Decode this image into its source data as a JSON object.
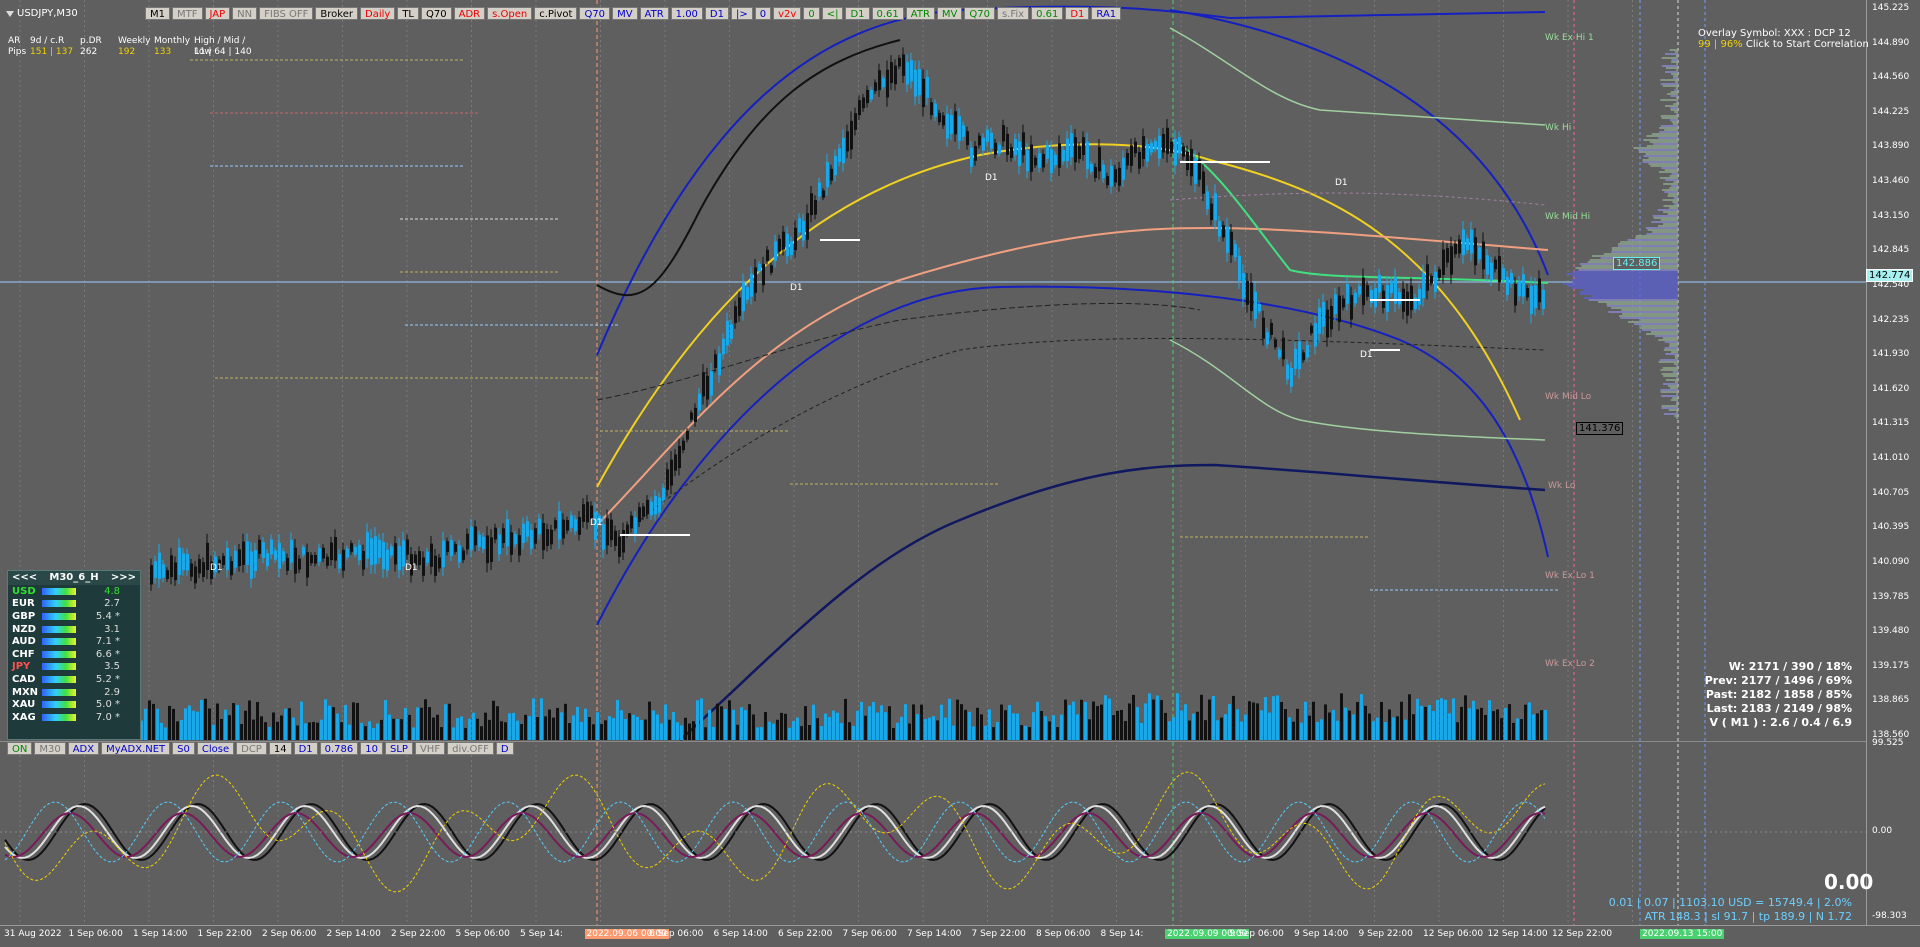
{
  "symbol_title": "USDJPY,M30",
  "toolbar": [
    {
      "label": "M1",
      "color": "black"
    },
    {
      "label": "MTF",
      "color": "grey"
    },
    {
      "label": "JAP",
      "color": "red"
    },
    {
      "label": "NN",
      "color": "grey"
    },
    {
      "label": "FIBS OFF",
      "color": "grey"
    },
    {
      "label": "Broker",
      "color": "black"
    },
    {
      "label": "Daily",
      "color": "red"
    },
    {
      "label": "TL",
      "color": "black"
    },
    {
      "label": "Q70",
      "color": "black"
    },
    {
      "label": "ADR",
      "color": "red"
    },
    {
      "label": "s.Open",
      "color": "red"
    },
    {
      "label": "c.Pivot",
      "color": "black"
    },
    {
      "label": "Q70",
      "color": "blue"
    },
    {
      "label": "MV",
      "color": "blue"
    },
    {
      "label": "ATR",
      "color": "blue"
    },
    {
      "label": "1.00",
      "color": "blue"
    },
    {
      "label": "D1",
      "color": "blue"
    },
    {
      "label": "|>",
      "color": "blue"
    },
    {
      "label": "0",
      "color": "blue"
    },
    {
      "label": "v2v",
      "color": "red"
    },
    {
      "label": "0",
      "color": "green"
    },
    {
      "label": "<|",
      "color": "green"
    },
    {
      "label": "D1",
      "color": "green"
    },
    {
      "label": "0.61",
      "color": "green"
    },
    {
      "label": "ATR",
      "color": "green"
    },
    {
      "label": "MV",
      "color": "green"
    },
    {
      "label": "Q70",
      "color": "green"
    },
    {
      "label": "s.Fix",
      "color": "grey"
    },
    {
      "label": "0.61",
      "color": "green"
    },
    {
      "label": "D1",
      "color": "red"
    },
    {
      "label": "RA1",
      "color": "blue"
    }
  ],
  "stats": {
    "header": [
      "AR",
      "9d / c.R",
      "p.DR",
      "Weekly",
      "Monthly",
      "High / Mid / Low"
    ],
    "values": [
      "Pips",
      "151 | 137",
      "262",
      "192",
      "133",
      "11 | 64 | 140"
    ]
  },
  "overlay": {
    "line1": "Overlay Symbol: XXX : DCP 12",
    "line2_pct": "99 | 96%",
    "line2_text": "Click to Start Correlation"
  },
  "strength_panel": {
    "nav_left": "<<<",
    "title": "M30_6_H",
    "nav_right": ">>>",
    "rows": [
      {
        "ccy": "USD",
        "value": "4.8",
        "color": "#30e030"
      },
      {
        "ccy": "EUR",
        "value": "2.7",
        "color": "#ffffff"
      },
      {
        "ccy": "GBP",
        "value": "5.4 *",
        "color": "#ffffff"
      },
      {
        "ccy": "NZD",
        "value": "3.1",
        "color": "#ffffff"
      },
      {
        "ccy": "AUD",
        "value": "7.1 *",
        "color": "#ffffff"
      },
      {
        "ccy": "CHF",
        "value": "6.6 *",
        "color": "#ffffff"
      },
      {
        "ccy": "JPY",
        "value": "3.5",
        "color": "#ff5050"
      },
      {
        "ccy": "CAD",
        "value": "5.2 *",
        "color": "#ffffff"
      },
      {
        "ccy": "MXN",
        "value": "2.9",
        "color": "#ffffff"
      },
      {
        "ccy": "XAU",
        "value": "5.0 *",
        "color": "#ffffff"
      },
      {
        "ccy": "XAG",
        "value": "7.0 *",
        "color": "#ffffff"
      }
    ]
  },
  "week_stats": {
    "w": "W: 2171 / 390 / 18%",
    "prev": "Prev: 2177 / 1496 / 69%",
    "past": "Past: 2182 / 1858 / 85%",
    "last": "Last: 2183 / 2149 / 98%",
    "v": "V ( M1 ) : 2.6 / 0.4 / 6.9"
  },
  "sub_toolbar": [
    {
      "label": "ON",
      "color": "green"
    },
    {
      "label": "M30",
      "color": "grey"
    },
    {
      "label": "ADX",
      "color": "blue"
    },
    {
      "label": "MyADX.NET",
      "color": "blue"
    },
    {
      "label": "S0",
      "color": "blue"
    },
    {
      "label": "Close",
      "color": "blue"
    },
    {
      "label": "DCP",
      "color": "grey"
    },
    {
      "label": "14",
      "color": "black"
    },
    {
      "label": "D1",
      "color": "blue"
    },
    {
      "label": "0.786",
      "color": "blue"
    },
    {
      "label": "10",
      "color": "blue"
    },
    {
      "label": "SLP",
      "color": "blue"
    },
    {
      "label": "VHF",
      "color": "grey"
    },
    {
      "label": "div.OFF",
      "color": "grey"
    },
    {
      "label": "D",
      "color": "blue"
    }
  ],
  "sub_value": "0.00",
  "bottom_stats": {
    "line1": "0.01  |  0.07  |  1103.10 USD = 15749.4  |  2.0%",
    "line2": "ATR 148.3  |  sl 91.7  |  tp 189.9  |  N 1.72"
  },
  "price_axis": [
    "145.225",
    "144.890",
    "144.560",
    "144.225",
    "143.890",
    "143.460",
    "143.150",
    "142.845",
    "142.540",
    "142.235",
    "141.930",
    "141.620",
    "141.315",
    "141.010",
    "140.705",
    "140.395",
    "140.090",
    "139.785",
    "139.480",
    "139.175",
    "138.865",
    "138.560"
  ],
  "price_tags": {
    "current": "142.774",
    "upper": "142.886",
    "lower": "141.376"
  },
  "sub_axis": [
    "99.525",
    "0.00",
    "-98.303"
  ],
  "week_labels": [
    "Wk Ex Hi 1",
    "Wk Hi",
    "Wk Mid Hi",
    "Wk Mid Lo",
    "Wk Lo",
    "Wk Ex Lo 1",
    "Wk Ex Lo 2"
  ],
  "d1_label": "D1",
  "time_axis": [
    {
      "label": "31 Aug 2022",
      "hl": ""
    },
    {
      "label": "1 Sep 06:00",
      "hl": ""
    },
    {
      "label": "1 Sep 14:00",
      "hl": ""
    },
    {
      "label": "1 Sep 22:00",
      "hl": ""
    },
    {
      "label": "2 Sep 06:00",
      "hl": ""
    },
    {
      "label": "2 Sep 14:00",
      "hl": ""
    },
    {
      "label": "2 Sep 22:00",
      "hl": ""
    },
    {
      "label": "5 Sep 06:00",
      "hl": ""
    },
    {
      "label": "5 Sep 14:",
      "hl": ""
    },
    {
      "label": "2022.09.06 00:00",
      "hl": "orange"
    },
    {
      "label": "6 Sep 06:00",
      "hl": ""
    },
    {
      "label": "6 Sep 14:00",
      "hl": ""
    },
    {
      "label": "6 Sep 22:00",
      "hl": ""
    },
    {
      "label": "7 Sep 06:00",
      "hl": ""
    },
    {
      "label": "7 Sep 14:00",
      "hl": ""
    },
    {
      "label": "7 Sep 22:00",
      "hl": ""
    },
    {
      "label": "8 Sep 06:00",
      "hl": ""
    },
    {
      "label": "8 Sep 14:",
      "hl": ""
    },
    {
      "label": "2022.09.09 00:00",
      "hl": "green"
    },
    {
      "label": "9 Sep 06:00",
      "hl": ""
    },
    {
      "label": "9 Sep 14:00",
      "hl": ""
    },
    {
      "label": "9 Sep 22:00",
      "hl": ""
    },
    {
      "label": "12 Sep 06:00",
      "hl": ""
    },
    {
      "label": "12 Sep 14:00",
      "hl": ""
    },
    {
      "label": "12 Sep 22:00",
      "hl": ""
    },
    {
      "label": "2022.09.13 15:00",
      "hl": "green"
    }
  ]
}
